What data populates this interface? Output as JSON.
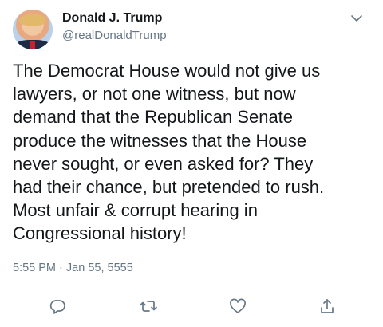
{
  "author": {
    "name": "Donald J. Trump",
    "handle": "@realDonaldTrump"
  },
  "tweet": {
    "text": "The Democrat House would not give us\nlawyers, or not one witness, but now\ndemand that the Republican Senate\nproduce the witnesses that the House\nnever sought, or even asked for? They\nhad their chance, but pretended to rush.\nMost unfair & corrupt hearing in\nCongressional history!",
    "time": "5:55 PM",
    "separator": "·",
    "date": "Jan 55, 5555"
  },
  "icons": {
    "menu": "chevron-down-icon",
    "reply": "reply-icon",
    "retweet": "retweet-icon",
    "like": "heart-icon",
    "share": "share-icon"
  },
  "colors": {
    "text": "#14171a",
    "secondary": "#657786",
    "divider": "#e1e8ed"
  }
}
